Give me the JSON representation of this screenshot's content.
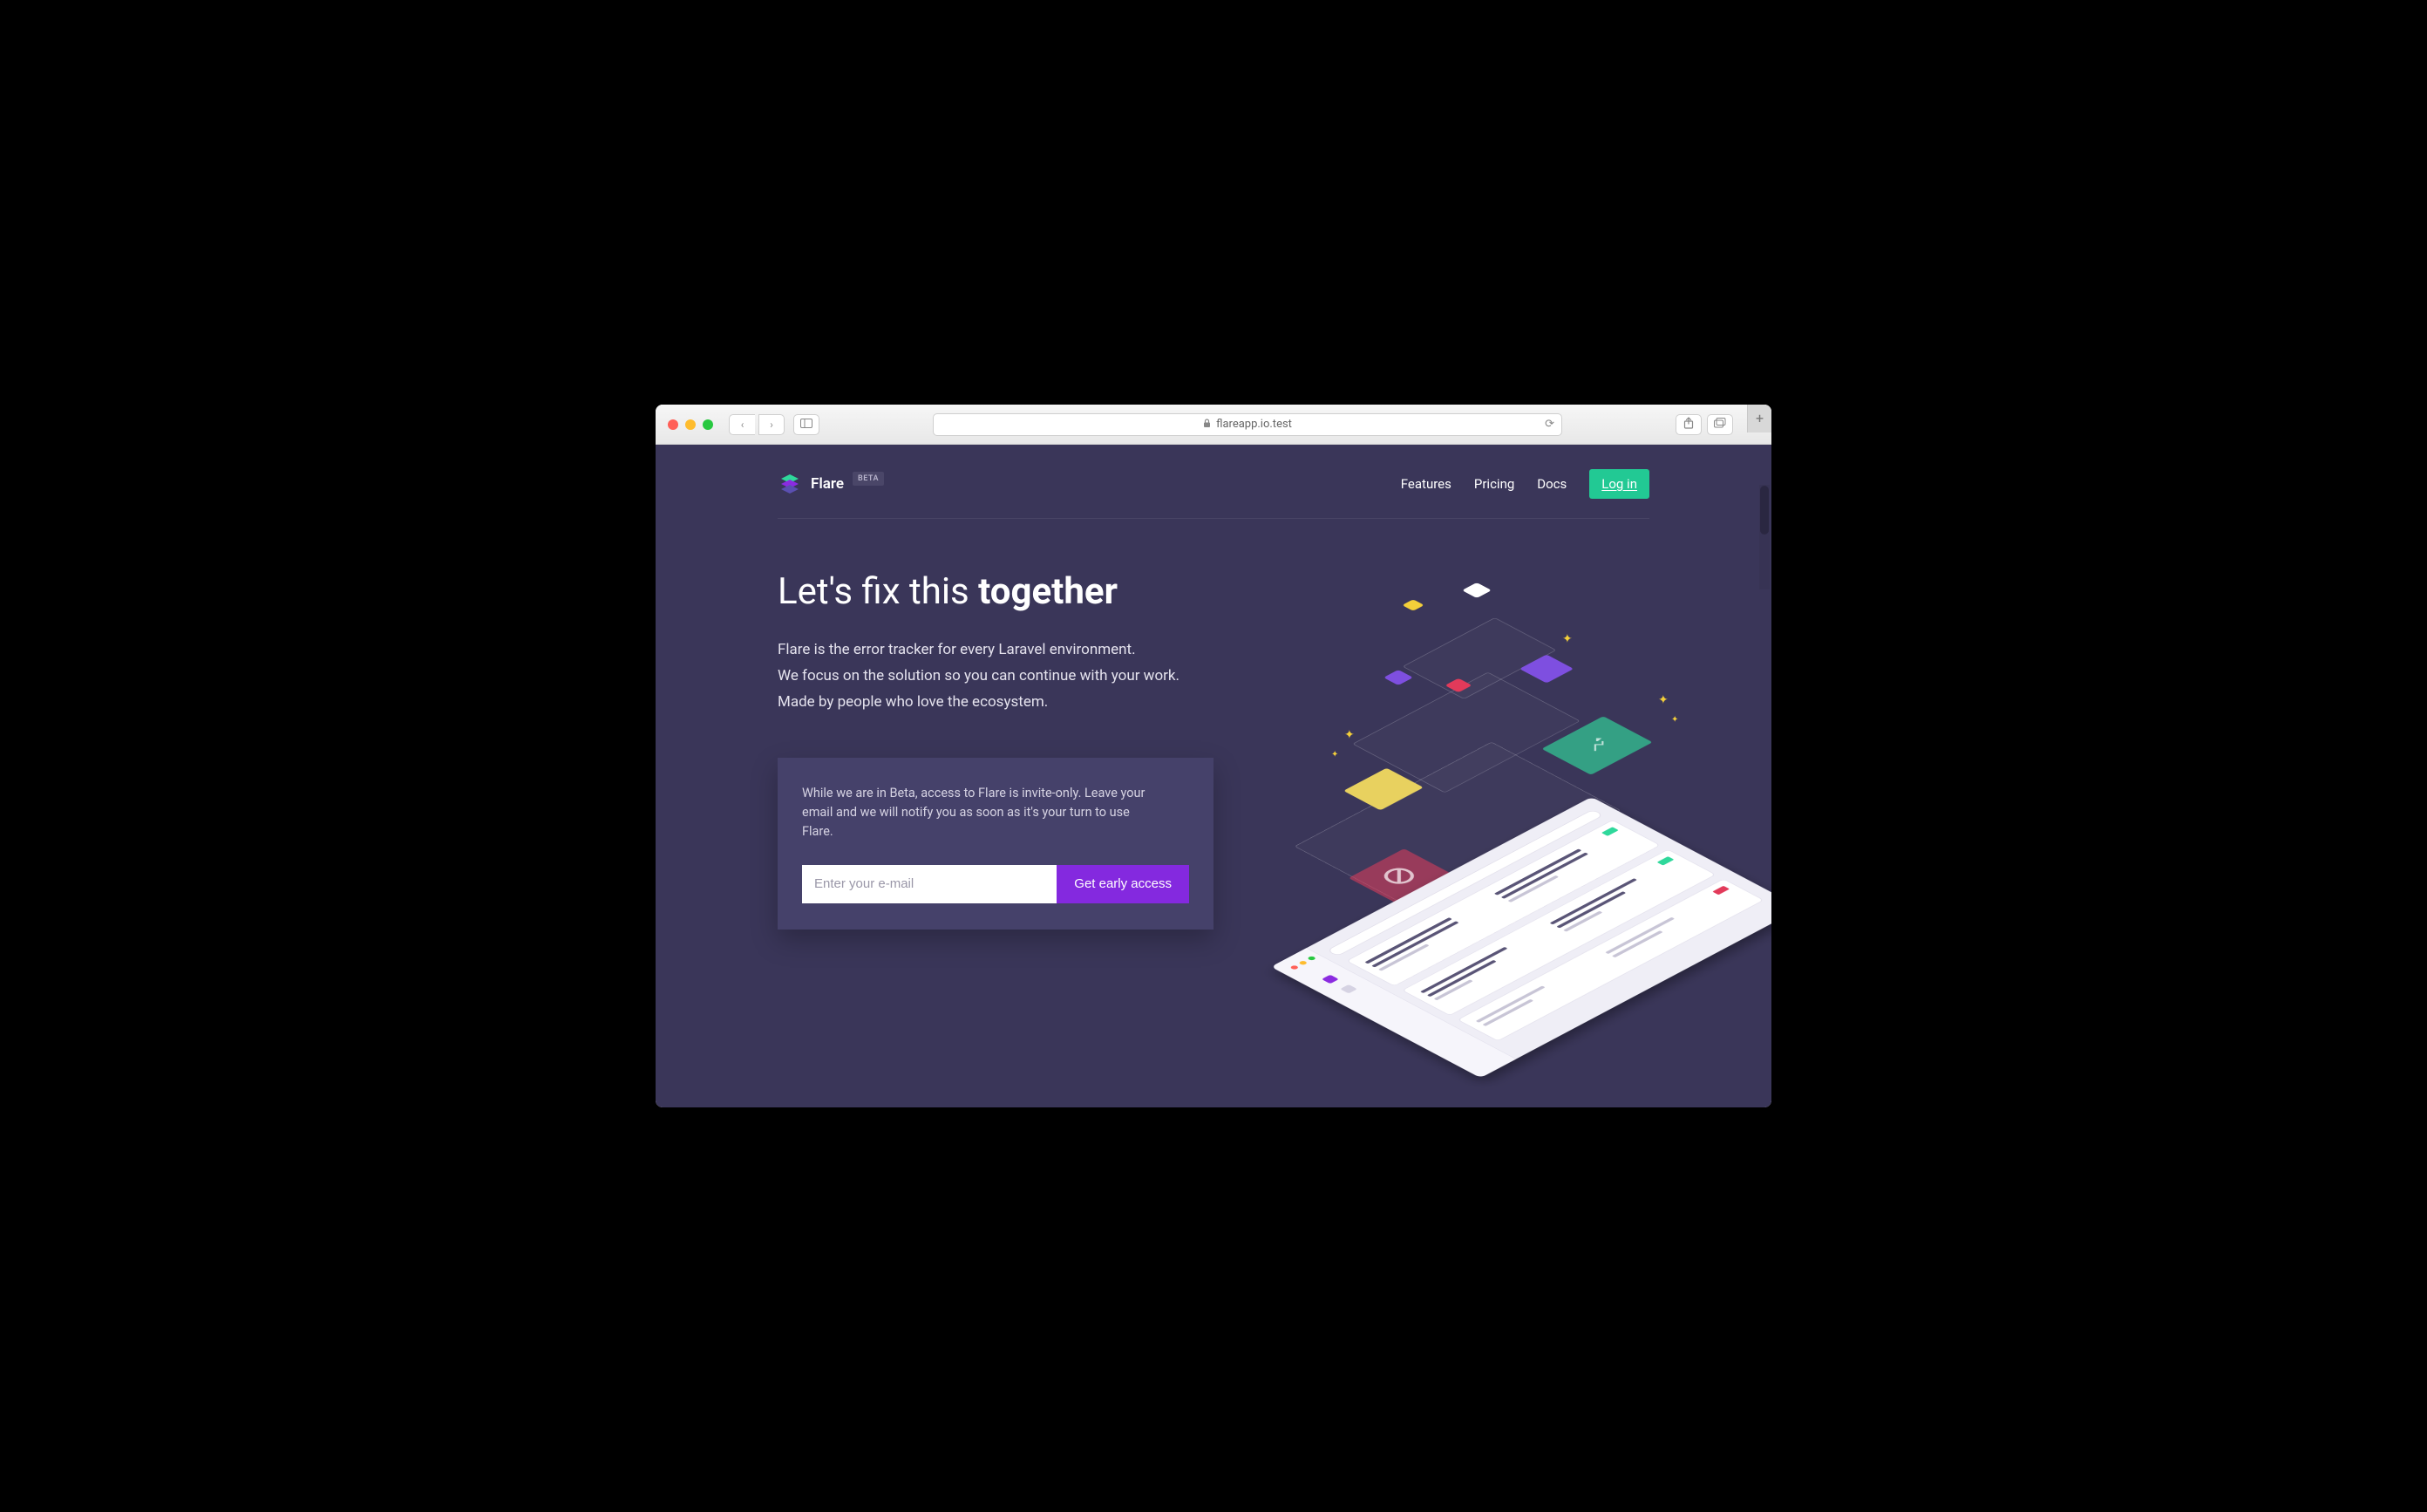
{
  "browser": {
    "url": "flareapp.io.test"
  },
  "nav": {
    "brand": "Flare",
    "badge": "BETA",
    "links": [
      "Features",
      "Pricing",
      "Docs"
    ],
    "login": "Log in"
  },
  "hero": {
    "title_prefix": "Let's fix this ",
    "title_bold": "together",
    "desc_l1": "Flare is the error tracker for every Laravel environment.",
    "desc_l2": "We focus on the solution so you can continue with your work.",
    "desc_l3": "Made by people who love the ecosystem."
  },
  "beta_box": {
    "text": "While we are in Beta, access to Flare is invite-only. Leave your email and we will notify you as soon as it's your turn to use Flare.",
    "placeholder": "Enter your e-mail",
    "cta": "Get early access"
  },
  "colors": {
    "bg": "#3a3659",
    "accent_green": "#22c994",
    "accent_purple": "#8429df"
  }
}
